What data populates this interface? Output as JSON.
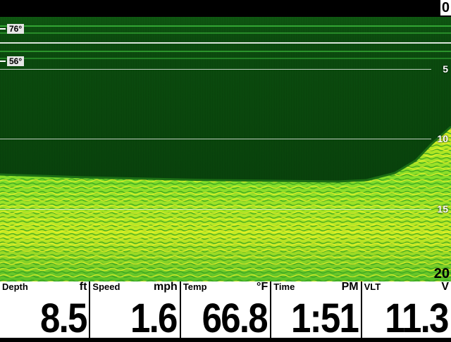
{
  "depth_scale": {
    "top": "0",
    "marks": [
      "5",
      "10",
      "15"
    ],
    "bottom": "20"
  },
  "temp_markers": [
    {
      "label": "76°"
    },
    {
      "label": "56°"
    }
  ],
  "colors": {
    "water": "#0a4a0d",
    "bottom_bright": "#e6f020",
    "bottom_green": "#38c22a",
    "databar_bg": "#ffffff"
  },
  "databar": [
    {
      "label": "Depth",
      "unit": "ft",
      "value": "8.5"
    },
    {
      "label": "Speed",
      "unit": "mph",
      "value": "1.6"
    },
    {
      "label": "Temp",
      "unit": "°F",
      "value": "66.8"
    },
    {
      "label": "Time",
      "unit": "PM",
      "value": "1:51"
    },
    {
      "label": "VLT",
      "unit": "V",
      "value": "11.3"
    }
  ]
}
